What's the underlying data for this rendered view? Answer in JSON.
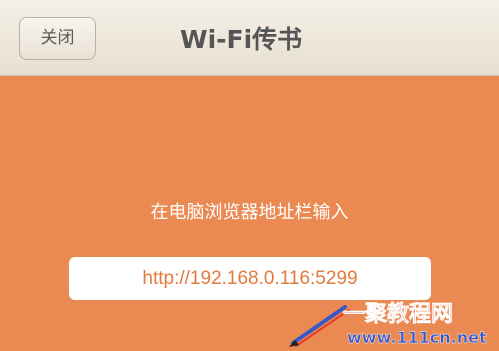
{
  "header": {
    "close_label": "关闭",
    "title": "Wi-Fi传书"
  },
  "main": {
    "instruction": "在电脑浏览器地址栏输入",
    "address": "http://192.168.0.116:5299"
  },
  "watermark": {
    "brand": "一聚教程网",
    "url": "www.111cn.net"
  },
  "colors": {
    "background": "#ea8a52",
    "header_bg": "#f4efe6",
    "accent_text": "#e27a3e"
  }
}
